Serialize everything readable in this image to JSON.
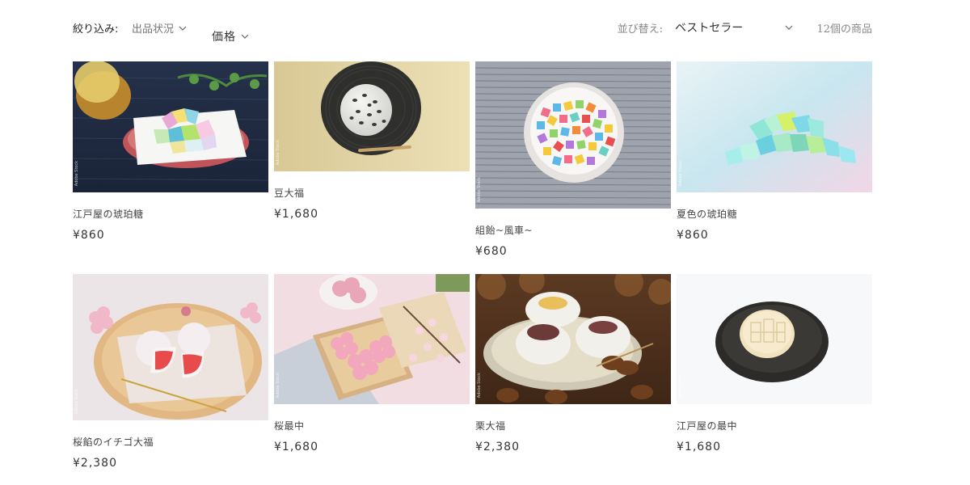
{
  "filters": {
    "label": "絞り込み:",
    "availability": "出品状況",
    "price": "価格"
  },
  "sort": {
    "label": "並び替え:",
    "selected": "ベストセラー"
  },
  "count": "12個の商品",
  "colors": {
    "text": "#333333",
    "muted": "#888888",
    "background": "#ffffff"
  },
  "products": [
    {
      "title": "江戸屋の琥珀糖",
      "price": "¥860"
    },
    {
      "title": "豆大福",
      "price": "¥1,680"
    },
    {
      "title": "組飴~風車~",
      "price": "¥680"
    },
    {
      "title": "夏色の琥珀糖",
      "price": "¥860"
    },
    {
      "title": "桜餡のイチゴ大福",
      "price": "¥2,380"
    },
    {
      "title": "桜最中",
      "price": "¥1,680"
    },
    {
      "title": "栗大福",
      "price": "¥2,380"
    },
    {
      "title": "江戸屋の最中",
      "price": "¥1,680"
    }
  ]
}
